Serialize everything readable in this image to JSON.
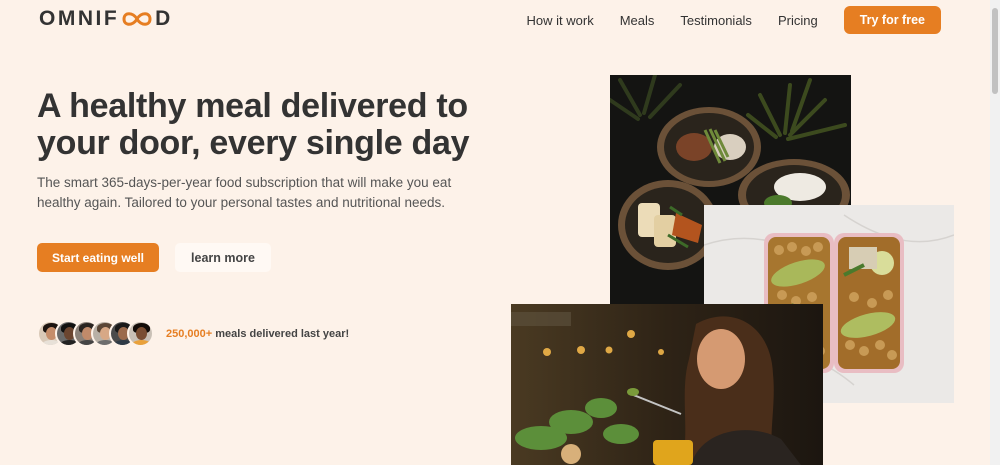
{
  "brand": {
    "logo_left": "OMNIF",
    "logo_right": "D"
  },
  "nav": {
    "links": [
      "How it work",
      "Meals",
      "Testimonials",
      "Pricing"
    ],
    "cta": "Try for free"
  },
  "hero": {
    "title": "A healthy meal delivered to your door, every single day",
    "description": "The smart 365-days-per-year food subscription that will make you eat healthy again. Tailored to your personal tastes and nutritional needs.",
    "primary_button": "Start eating well",
    "secondary_button": "learn more"
  },
  "social_proof": {
    "count": "250,000+",
    "text": " meals delivered last year!",
    "avatar_count": 6
  },
  "colors": {
    "background": "#fdf2e9",
    "accent": "#e67e22",
    "text": "#333333"
  },
  "icons": [
    "infinity-icon",
    "customer-avatar"
  ]
}
